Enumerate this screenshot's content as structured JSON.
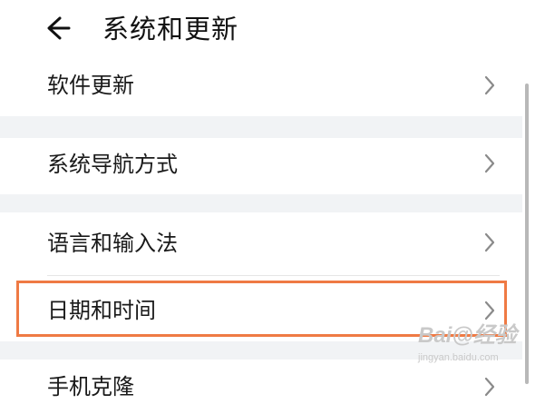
{
  "header": {
    "title": "系统和更新",
    "back_icon": "back-arrow-icon"
  },
  "menu": {
    "items": [
      {
        "label": "软件更新",
        "icon": "chevron-right-icon"
      },
      {
        "label": "系统导航方式",
        "icon": "chevron-right-icon"
      },
      {
        "label": "语言和输入法",
        "icon": "chevron-right-icon"
      },
      {
        "label": "日期和时间",
        "icon": "chevron-right-icon",
        "highlighted": true
      },
      {
        "label": "手机克隆",
        "icon": "chevron-right-icon"
      }
    ]
  },
  "watermark": {
    "line1": "Bai@经验",
    "line2": "jingyan.baidu.com"
  },
  "colors": {
    "highlight_border": "#ef7a44",
    "section_gap": "#f1f3f5",
    "text": "#1a1a1a",
    "chevron": "#8a8a8a"
  }
}
